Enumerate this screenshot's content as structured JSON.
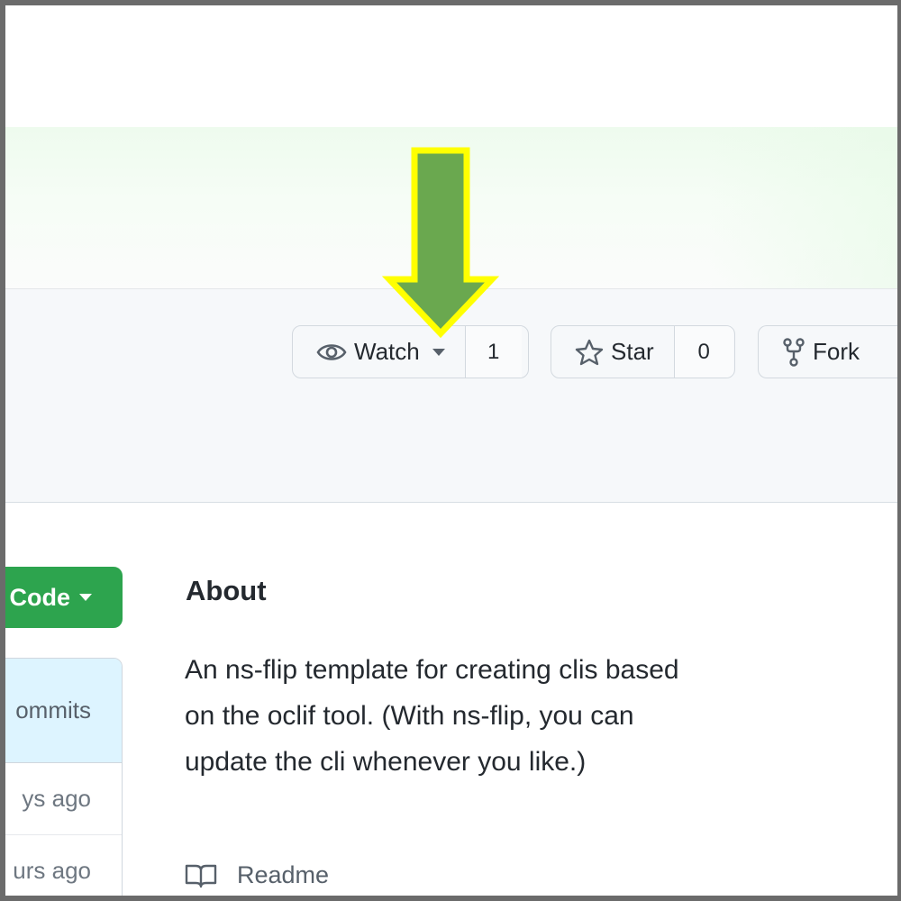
{
  "colors": {
    "accent_green": "#2da44e",
    "arrow_fill": "#6aa84f",
    "arrow_outline": "#ffff00"
  },
  "repo_actions": {
    "watch": {
      "label": "Watch",
      "count": "1",
      "icon": "eye-icon"
    },
    "star": {
      "label": "Star",
      "count": "0",
      "icon": "star-icon"
    },
    "fork": {
      "label": "Fork",
      "icon": "repo-forked-icon"
    }
  },
  "code_button": {
    "label": "Code"
  },
  "file_list": {
    "commits_label": "ommits",
    "rows": [
      "ys ago",
      "urs ago"
    ]
  },
  "about": {
    "title": "About",
    "description": "An ns-flip template for creating clis based on the oclif tool. (With ns-flip, you can update the cli whenever you like.)",
    "readme_label": "Readme",
    "readme_icon": "book-icon"
  },
  "annotation": {
    "icon": "down-arrow-icon"
  }
}
